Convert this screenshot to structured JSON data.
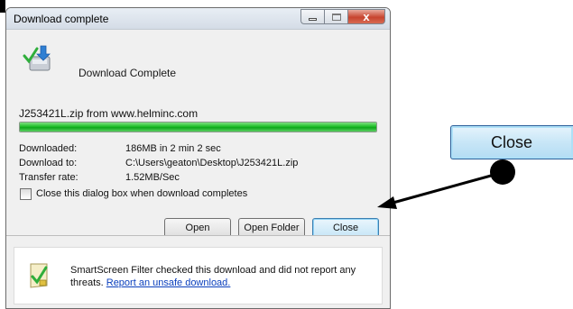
{
  "dialog": {
    "title": "Download complete",
    "heading": "Download Complete",
    "file_line": "J253421L.zip from www.helminc.com",
    "progress_fraction": 1.0,
    "info": [
      {
        "label": "Downloaded:",
        "value": "186MB in 2 min 2 sec"
      },
      {
        "label": "Download to:",
        "value": "C:\\Users\\geaton\\Desktop\\J253421L.zip"
      },
      {
        "label": "Transfer rate:",
        "value": "1.52MB/Sec"
      }
    ],
    "checkbox_label": "Close this dialog box when download completes",
    "checkbox_checked": false,
    "buttons": {
      "open": "Open",
      "open_folder": "Open Folder",
      "close": "Close"
    },
    "footer": {
      "text": "SmartScreen Filter checked this download and did not report any threats.",
      "link": "Report an unsafe download."
    }
  },
  "callout": {
    "zoom_label": "Close"
  },
  "colors": {
    "progress_green": "#1fbf2a",
    "close_caption_red": "#c7442f",
    "link_blue": "#0a3fbd",
    "default_button_border": "#3c7fb1"
  },
  "icons": [
    "download-complete-icon",
    "smartscreen-shield-icon",
    "minimize-icon",
    "maximize-icon",
    "close-icon"
  ]
}
